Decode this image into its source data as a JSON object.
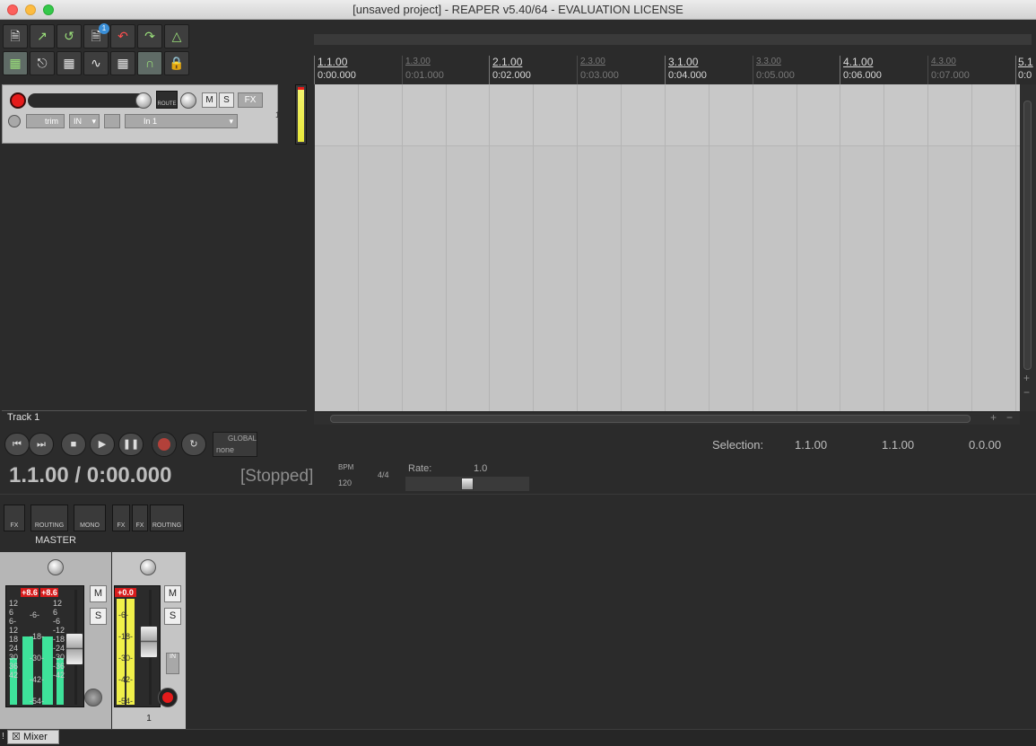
{
  "window": {
    "title": "[unsaved project] - REAPER v5.40/64 - EVALUATION LICENSE"
  },
  "toolbar": {
    "row1": [
      "new-project",
      "open-project",
      "save-project",
      "project-settings",
      "undo",
      "redo",
      "metronome"
    ],
    "row2": [
      "grid-snap",
      "ripple-edit",
      "auto-crossfade",
      "envelope-lock",
      "grid",
      "snap-loop",
      "lock"
    ],
    "badge": "1"
  },
  "track": {
    "name": "Track 1",
    "number": "1",
    "route_label": "ROUTE",
    "m_label": "M",
    "s_label": "S",
    "fx_label": "FX",
    "trim_label": "trim",
    "in_label": "IN",
    "input_label": "In 1"
  },
  "ruler": {
    "bars": [
      {
        "label": "1.1.00",
        "time": "0:00.000"
      },
      {
        "label": "2.1.00",
        "time": "0:02.000"
      },
      {
        "label": "3.1.00",
        "time": "0:04.000"
      },
      {
        "label": "4.1.00",
        "time": "0:06.000"
      },
      {
        "label": "5.1",
        "time": "0:0"
      }
    ],
    "beats": [
      {
        "label": "1.3.00",
        "time": "0:01.000"
      },
      {
        "label": "2.3.00",
        "time": "0:03.000"
      },
      {
        "label": "3.3.00",
        "time": "0:05.000"
      },
      {
        "label": "4.3.00",
        "time": "0:07.000"
      }
    ]
  },
  "transport": {
    "position": "1.1.00 / 0:00.000",
    "state": "[Stopped]",
    "bpm_label": "BPM",
    "bpm": "120",
    "time_sig": "4/4",
    "rate_label": "Rate:",
    "rate": "1.0",
    "global_label": "GLOBAL",
    "global_value": "none",
    "selection_label": "Selection:",
    "selection_start": "1.1.00",
    "selection_end": "1.1.00",
    "selection_length": "0.0.00"
  },
  "mixer": {
    "master_label": "MASTER",
    "fx_label": "FX",
    "routing_label": "ROUTING",
    "mono_label": "MONO",
    "in_label": "IN",
    "m_label": "M",
    "s_label": "S",
    "master_peak_l": "+8.6",
    "master_peak_r": "+8.6",
    "track_peak": "+0.0",
    "master_scale_left": [
      "12",
      "6",
      "6-",
      "12",
      "18",
      "24",
      "30",
      "36",
      "42"
    ],
    "master_scale_mid": [
      "-6-",
      "-18-",
      "-30-",
      "-42-",
      "-54-"
    ],
    "master_scale_right": [
      "12",
      "6",
      "-6",
      "-12",
      "-18",
      "-24",
      "-30",
      "-36",
      "-42"
    ],
    "track_scale": [
      "-6-",
      "-18-",
      "-30-",
      "-42-",
      "-54-"
    ],
    "track_number": "1",
    "tab_label": "Mixer",
    "tab_marker": "!"
  }
}
